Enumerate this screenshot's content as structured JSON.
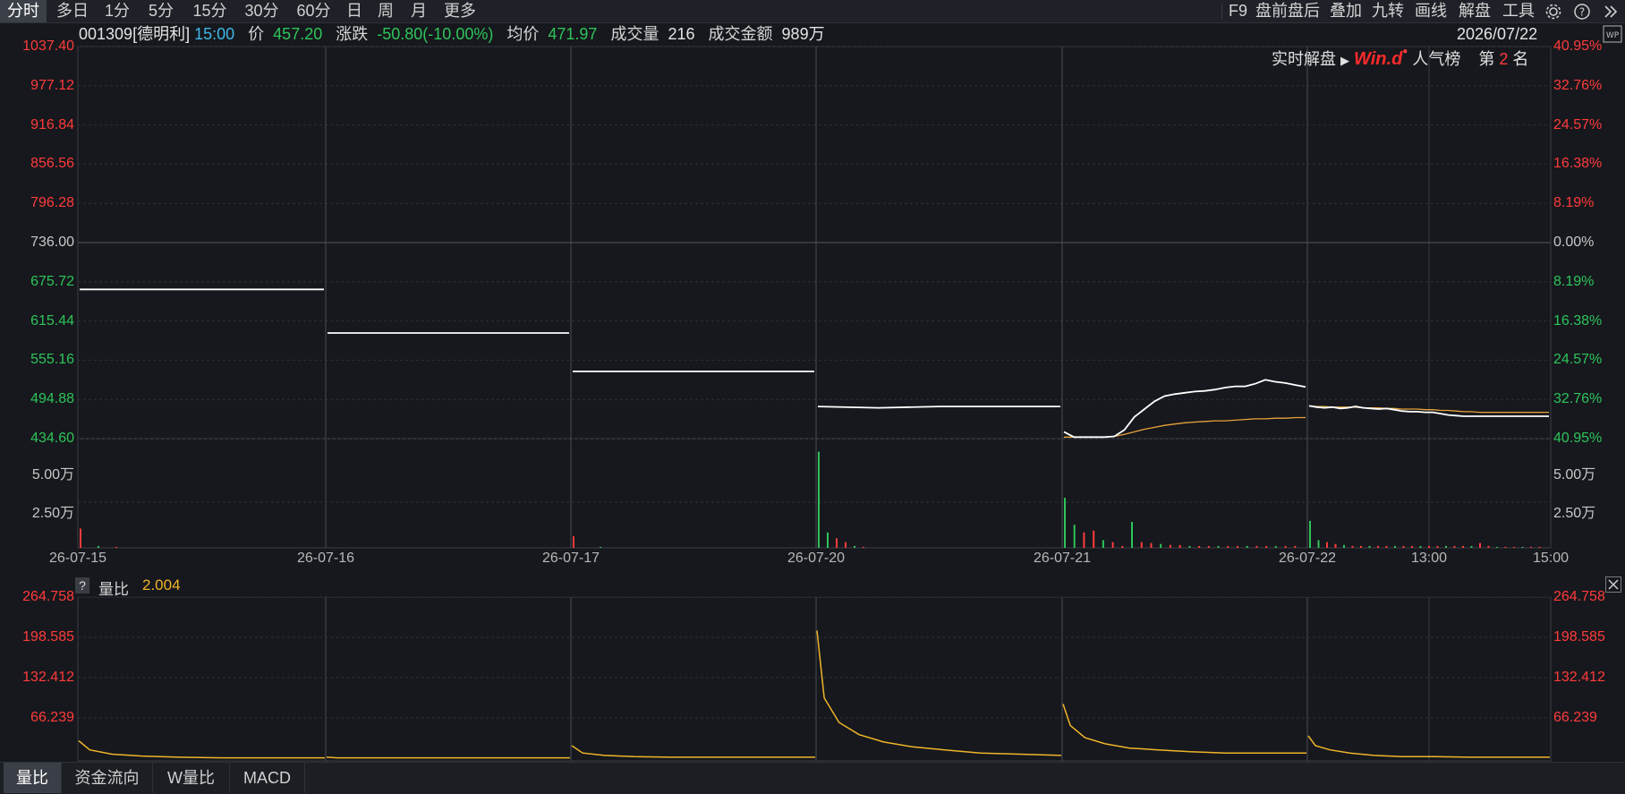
{
  "toolbar": {
    "periods": [
      "分时",
      "多日",
      "1分",
      "5分",
      "15分",
      "30分",
      "60分",
      "日",
      "周",
      "月",
      "更多"
    ],
    "active_period": "分时",
    "right_items": [
      "F9",
      "盘前盘后",
      "叠加",
      "九转",
      "画线",
      "解盘",
      "工具"
    ]
  },
  "quote": {
    "code_name": "001309[德明利]",
    "time": "15:00",
    "price_label": "价",
    "price": "457.20",
    "change_label": "涨跌",
    "change": "-50.80(-10.00%)",
    "avg_label": "均价",
    "avg": "471.97",
    "volume_label": "成交量",
    "volume": "216",
    "amount_label": "成交金额",
    "amount": "989万",
    "date": "2026/07/22"
  },
  "badge": {
    "realtime": "实时解盘",
    "brand": "Win.d",
    "popularity": "人气榜",
    "rank_prefix": "第",
    "rank": "2",
    "rank_suffix": "名"
  },
  "colors": {
    "background": "#16181d",
    "price_line": "#ffffff",
    "avg_line": "#e8a23a",
    "up": "#ff3b3b",
    "down": "#2ec45a",
    "ratio_line": "#f0b429"
  },
  "indicator": {
    "help": "?",
    "name": "量比",
    "value": "2.004"
  },
  "bottom_tabs": [
    "量比",
    "资金流向",
    "W量比",
    "MACD"
  ],
  "active_bottom_tab": "量比",
  "chart_data": [
    {
      "type": "line",
      "title": "",
      "x": [
        "26-07-15",
        "26-07-16",
        "26-07-17",
        "26-07-20",
        "26-07-21",
        "26-07-22",
        "13:00",
        "15:00"
      ],
      "y_left_ticks": [
        "1037.40",
        "977.12",
        "916.84",
        "856.56",
        "796.28",
        "736.00",
        "675.72",
        "615.44",
        "555.16",
        "494.88",
        "434.60"
      ],
      "y_right_ticks": [
        "40.95%",
        "32.76%",
        "24.57%",
        "16.38%",
        "8.19%",
        "0.00%",
        "8.19%",
        "16.38%",
        "24.57%",
        "32.76%",
        "40.95%"
      ],
      "ylim": [
        434.6,
        1037.4
      ],
      "prev_close": 736.0,
      "series": [
        {
          "day": "26-07-15",
          "price": [
            664,
            664,
            664,
            664,
            664
          ]
        },
        {
          "day": "26-07-16",
          "price": [
            597,
            597,
            597,
            597,
            597
          ]
        },
        {
          "day": "26-07-17",
          "price": [
            538,
            538,
            538,
            538,
            538
          ]
        },
        {
          "day": "26-07-20",
          "price": [
            484,
            482,
            484,
            484,
            484
          ]
        },
        {
          "day": "26-07-21",
          "price": [
            445,
            437,
            437,
            437,
            437,
            438,
            448,
            468,
            480,
            492,
            500,
            503,
            505,
            507,
            508,
            510,
            513,
            515,
            515,
            519,
            525,
            522,
            520,
            517,
            514
          ],
          "avg": [
            437,
            437,
            437,
            437,
            437,
            438,
            441,
            445,
            449,
            452,
            455,
            457,
            459,
            460,
            461,
            462,
            462,
            463,
            464,
            465,
            465,
            466,
            466,
            467,
            467
          ]
        },
        {
          "day": "26-07-22",
          "price": [
            485,
            483,
            482,
            483,
            481,
            482,
            484,
            482,
            481,
            480,
            481,
            479,
            477,
            476,
            476,
            475,
            475,
            473,
            471,
            470,
            469,
            469,
            469,
            469,
            469,
            469,
            469,
            469,
            469,
            469,
            469,
            469
          ],
          "avg": [
            485,
            484,
            484,
            483,
            483,
            483,
            483,
            482,
            482,
            482,
            481,
            481,
            480,
            480,
            480,
            479,
            479,
            478,
            478,
            477,
            476,
            476,
            475,
            475,
            475,
            475,
            475,
            475,
            475,
            475,
            475,
            475
          ]
        }
      ]
    },
    {
      "type": "bar",
      "title": "",
      "y_ticks": [
        "5.00万",
        "2.50万"
      ],
      "volume_bars": [
        {
          "day": "26-07-15",
          "values": [
            1.0,
            0.1,
            0.05
          ]
        },
        {
          "day": "26-07-17",
          "values": [
            0.6,
            0.05
          ]
        },
        {
          "day": "26-07-20",
          "values": [
            5.0,
            0.8,
            0.5,
            0.3,
            0.1,
            0.05
          ]
        },
        {
          "day": "26-07-21",
          "values": [
            2.6,
            1.2,
            0.8,
            0.9,
            0.4,
            0.3,
            0.1,
            1.35,
            0.3,
            0.25,
            0.2,
            0.15,
            0.15,
            0.1,
            0.1,
            0.1,
            0.1,
            0.1,
            0.1,
            0.1,
            0.1,
            0.1,
            0.1,
            0.1,
            0.1
          ]
        },
        {
          "day": "26-07-22",
          "values": [
            1.4,
            0.4,
            0.3,
            0.2,
            0.15,
            0.1,
            0.1,
            0.1,
            0.1,
            0.1,
            0.1,
            0.1,
            0.1,
            0.1,
            0.1,
            0.1,
            0.1,
            0.1,
            0.1,
            0.1,
            0.25,
            0.1,
            0.05,
            0.05,
            0.05,
            0.05,
            0.05,
            0.05
          ]
        }
      ]
    },
    {
      "type": "line",
      "title": "",
      "name": "量比",
      "y_ticks": [
        "264.758",
        "198.585",
        "132.412",
        "66.239"
      ],
      "ylim": [
        0,
        264.758
      ],
      "series": [
        {
          "day": "26-07-15",
          "ratio": [
            30,
            15,
            8,
            5,
            3,
            2,
            2,
            2
          ]
        },
        {
          "day": "26-07-16",
          "ratio": [
            3,
            2,
            2,
            2,
            2,
            2,
            2,
            2
          ]
        },
        {
          "day": "26-07-17",
          "ratio": [
            22,
            10,
            6,
            4,
            3,
            3,
            3,
            3
          ]
        },
        {
          "day": "26-07-20",
          "ratio": [
            210,
            100,
            60,
            40,
            28,
            20,
            15,
            10,
            8,
            6
          ]
        },
        {
          "day": "26-07-21",
          "ratio": [
            90,
            55,
            35,
            25,
            18,
            15,
            12,
            10,
            10,
            10
          ]
        },
        {
          "day": "26-07-22",
          "ratio": [
            38,
            22,
            15,
            10,
            6,
            4,
            4,
            3,
            3,
            3
          ]
        }
      ]
    }
  ]
}
